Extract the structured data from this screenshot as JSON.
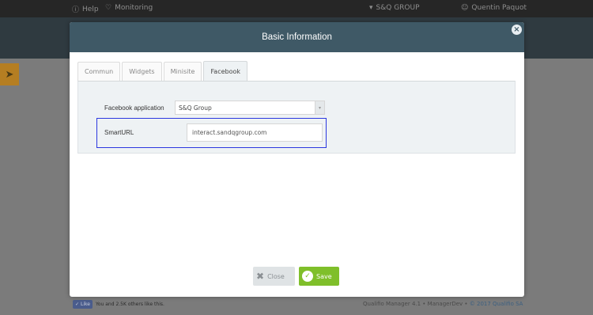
{
  "topbar": {
    "help_label": "Help",
    "monitoring_label": "Monitoring",
    "org_label": "S&Q GROUP",
    "user_label": "Quentin Paquot"
  },
  "modal": {
    "title": "Basic Information",
    "tabs": [
      {
        "label": "Commun",
        "active": false
      },
      {
        "label": "Widgets",
        "active": false
      },
      {
        "label": "Minisite",
        "active": false
      },
      {
        "label": "Facebook",
        "active": true
      }
    ],
    "form": {
      "facebook_app_label": "Facebook application",
      "facebook_app_value": "S&Q Group",
      "smarturl_label": "SmartURL",
      "smarturl_value": "interact.sandqgroup.com"
    },
    "buttons": {
      "close_label": "Close",
      "save_label": "Save"
    }
  },
  "footer": {
    "like_button": "Like",
    "like_text": "You and 2.5K others like this.",
    "version_text": "Qualifio Manager 4.1 • ManagerDev •",
    "copyright": "© 2017 Qualifio SA"
  },
  "colors": {
    "header": "#3f5966",
    "save": "#7fbf2a",
    "highlight": "#2b37e0",
    "accent_rocket": "#b57e22"
  }
}
